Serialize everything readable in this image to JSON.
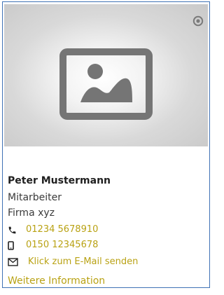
{
  "card": {
    "name": "Peter Mustermann",
    "role": "Mitarbeiter",
    "company": "Firma xyz",
    "phone": "01234 5678910",
    "mobile": "0150 12345678",
    "email_link": "Klick zum E-Mail senden",
    "more_link": "Weitere Information"
  },
  "icons": {
    "photo": "image-placeholder-icon",
    "corner": "target-icon",
    "phone": "phone-icon",
    "mobile": "mobile-icon",
    "email": "envelope-icon"
  },
  "colors": {
    "border": "#3f72b5",
    "link": "#b9a214",
    "icon_gray": "#7b7b7b",
    "text_dark": "#1f1f1f"
  }
}
